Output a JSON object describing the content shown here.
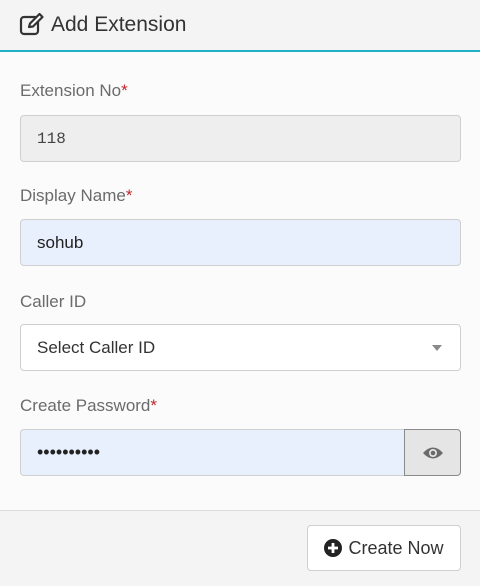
{
  "header": {
    "title": "Add Extension",
    "icon": "edit-icon",
    "accent_color": "#1fb1c6"
  },
  "fields": {
    "extension_no": {
      "label": "Extension No",
      "required_mark": "*",
      "value": "118",
      "disabled": true
    },
    "display_name": {
      "label": "Display Name",
      "required_mark": "*",
      "value": "sohub"
    },
    "caller_id": {
      "label": "Caller ID",
      "selected": "Select Caller ID"
    },
    "password": {
      "label": "Create Password",
      "required_mark": "*",
      "masked_value": "••••••••••",
      "toggle_icon": "eye-icon"
    }
  },
  "footer": {
    "create_label": "Create Now",
    "create_icon": "plus-circle-icon"
  },
  "colors": {
    "required": "#c0272d",
    "autofill_bg": "#e8f0fe"
  }
}
